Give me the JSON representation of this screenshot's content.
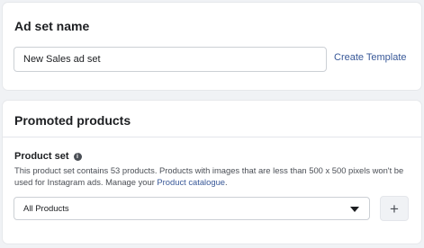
{
  "ad_set_name": {
    "title": "Ad set name",
    "input_value": "New Sales ad set",
    "create_template_label": "Create Template"
  },
  "promoted_products": {
    "title": "Promoted products",
    "product_set_label": "Product set",
    "info_icon": "info-icon",
    "help_text_before_link": "This product set contains 53 products. Products with images that are less than 500 x 500 pixels won't be used for Instagram ads. Manage your ",
    "help_link": "Product catalogue",
    "help_text_after_link": ".",
    "selected_option": "All Products",
    "add_icon": "plus-icon"
  },
  "colors": {
    "background": "#f0f2f5",
    "card": "#ffffff",
    "link": "#385898",
    "text": "#1c1e21",
    "secondary_text": "#4b4f56"
  }
}
